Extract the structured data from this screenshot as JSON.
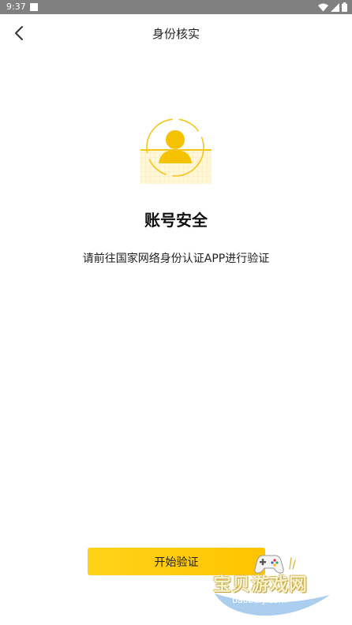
{
  "status_bar": {
    "time": "9:37",
    "icons": [
      "wifi-icon",
      "signal-icon",
      "battery-icon"
    ]
  },
  "header": {
    "title": "身份核实",
    "back_icon": "chevron-left-icon"
  },
  "main": {
    "illustration_icon": "id-card-avatar-icon",
    "headline": "账号安全",
    "message": "请前往国家网络身份认证APP进行验证"
  },
  "footer": {
    "start_button_label": "开始验证"
  },
  "watermark": {
    "title": "宝贝游戏网",
    "url": "baobeiy.com"
  },
  "colors": {
    "accent": "#ffc800",
    "status_bar": "#808080",
    "text": "#222222"
  }
}
